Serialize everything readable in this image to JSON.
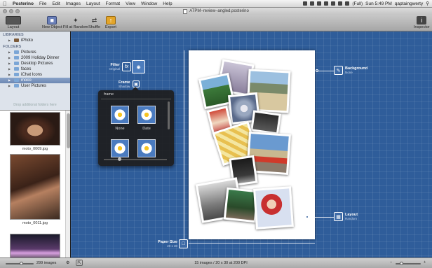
{
  "menubar": {
    "app": "Posterino",
    "items": [
      "File",
      "Edit",
      "Images",
      "Layout",
      "Format",
      "View",
      "Window",
      "Help"
    ],
    "battery": "(Full)",
    "clock": "Sun 5:49 PM",
    "user": "qaptaingwerty"
  },
  "window": {
    "title": "ATPM–review–angled.posterino"
  },
  "toolbar": {
    "layout": "Layout",
    "new_object": "New Object",
    "fill_at_random": "Fill at Random",
    "shuffle": "Shuffle",
    "export": "Export",
    "inspector": "Inspector"
  },
  "sidebar": {
    "libraries_header": "LIBRARIES",
    "libraries": [
      {
        "label": "iPhoto"
      }
    ],
    "folders_header": "FOLDERS",
    "folders": [
      {
        "label": "Pictures"
      },
      {
        "label": "2009 Holiday Dinner"
      },
      {
        "label": "Desktop Pictures"
      },
      {
        "label": "faces"
      },
      {
        "label": "iChat Icons"
      },
      {
        "label": "moco"
      },
      {
        "label": "User Pictures"
      }
    ],
    "drop_hint": "Drop additional folders here",
    "thumbnails": [
      {
        "caption": "moto_0009.jpg"
      },
      {
        "caption": "moto_0011.jpg"
      }
    ]
  },
  "canvas": {
    "filter_label": "Filter",
    "filter_value": "Original",
    "frame_label": "Frame",
    "frame_value": "Shadow",
    "background_label": "Background",
    "background_value": "None",
    "layout_label": "Layout",
    "layout_value": "Random",
    "paper_size_label": "Paper Size",
    "paper_size_value": "20 x 30"
  },
  "popover": {
    "title": "frame",
    "options": [
      {
        "label": "None"
      },
      {
        "label": "Date"
      }
    ]
  },
  "statusbar": {
    "image_count": "299 images",
    "summary": "15 images / 20 x 30 at 200 DPI"
  },
  "colors": {
    "canvas_blue": "#2f5d9a",
    "selection": "#6c87b2"
  }
}
